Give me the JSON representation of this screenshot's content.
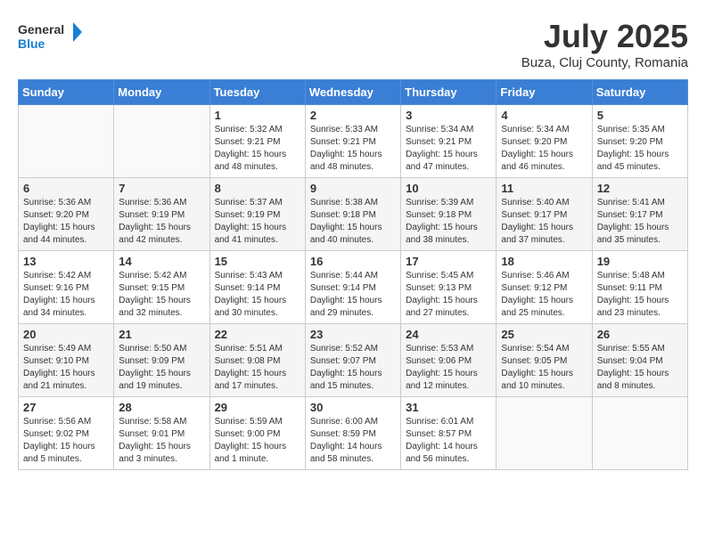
{
  "header": {
    "logo_line1": "General",
    "logo_line2": "Blue",
    "month": "July 2025",
    "location": "Buza, Cluj County, Romania"
  },
  "weekdays": [
    "Sunday",
    "Monday",
    "Tuesday",
    "Wednesday",
    "Thursday",
    "Friday",
    "Saturday"
  ],
  "weeks": [
    [
      {
        "day": "",
        "info": ""
      },
      {
        "day": "",
        "info": ""
      },
      {
        "day": "1",
        "info": "Sunrise: 5:32 AM\nSunset: 9:21 PM\nDaylight: 15 hours and 48 minutes."
      },
      {
        "day": "2",
        "info": "Sunrise: 5:33 AM\nSunset: 9:21 PM\nDaylight: 15 hours and 48 minutes."
      },
      {
        "day": "3",
        "info": "Sunrise: 5:34 AM\nSunset: 9:21 PM\nDaylight: 15 hours and 47 minutes."
      },
      {
        "day": "4",
        "info": "Sunrise: 5:34 AM\nSunset: 9:20 PM\nDaylight: 15 hours and 46 minutes."
      },
      {
        "day": "5",
        "info": "Sunrise: 5:35 AM\nSunset: 9:20 PM\nDaylight: 15 hours and 45 minutes."
      }
    ],
    [
      {
        "day": "6",
        "info": "Sunrise: 5:36 AM\nSunset: 9:20 PM\nDaylight: 15 hours and 44 minutes."
      },
      {
        "day": "7",
        "info": "Sunrise: 5:36 AM\nSunset: 9:19 PM\nDaylight: 15 hours and 42 minutes."
      },
      {
        "day": "8",
        "info": "Sunrise: 5:37 AM\nSunset: 9:19 PM\nDaylight: 15 hours and 41 minutes."
      },
      {
        "day": "9",
        "info": "Sunrise: 5:38 AM\nSunset: 9:18 PM\nDaylight: 15 hours and 40 minutes."
      },
      {
        "day": "10",
        "info": "Sunrise: 5:39 AM\nSunset: 9:18 PM\nDaylight: 15 hours and 38 minutes."
      },
      {
        "day": "11",
        "info": "Sunrise: 5:40 AM\nSunset: 9:17 PM\nDaylight: 15 hours and 37 minutes."
      },
      {
        "day": "12",
        "info": "Sunrise: 5:41 AM\nSunset: 9:17 PM\nDaylight: 15 hours and 35 minutes."
      }
    ],
    [
      {
        "day": "13",
        "info": "Sunrise: 5:42 AM\nSunset: 9:16 PM\nDaylight: 15 hours and 34 minutes."
      },
      {
        "day": "14",
        "info": "Sunrise: 5:42 AM\nSunset: 9:15 PM\nDaylight: 15 hours and 32 minutes."
      },
      {
        "day": "15",
        "info": "Sunrise: 5:43 AM\nSunset: 9:14 PM\nDaylight: 15 hours and 30 minutes."
      },
      {
        "day": "16",
        "info": "Sunrise: 5:44 AM\nSunset: 9:14 PM\nDaylight: 15 hours and 29 minutes."
      },
      {
        "day": "17",
        "info": "Sunrise: 5:45 AM\nSunset: 9:13 PM\nDaylight: 15 hours and 27 minutes."
      },
      {
        "day": "18",
        "info": "Sunrise: 5:46 AM\nSunset: 9:12 PM\nDaylight: 15 hours and 25 minutes."
      },
      {
        "day": "19",
        "info": "Sunrise: 5:48 AM\nSunset: 9:11 PM\nDaylight: 15 hours and 23 minutes."
      }
    ],
    [
      {
        "day": "20",
        "info": "Sunrise: 5:49 AM\nSunset: 9:10 PM\nDaylight: 15 hours and 21 minutes."
      },
      {
        "day": "21",
        "info": "Sunrise: 5:50 AM\nSunset: 9:09 PM\nDaylight: 15 hours and 19 minutes."
      },
      {
        "day": "22",
        "info": "Sunrise: 5:51 AM\nSunset: 9:08 PM\nDaylight: 15 hours and 17 minutes."
      },
      {
        "day": "23",
        "info": "Sunrise: 5:52 AM\nSunset: 9:07 PM\nDaylight: 15 hours and 15 minutes."
      },
      {
        "day": "24",
        "info": "Sunrise: 5:53 AM\nSunset: 9:06 PM\nDaylight: 15 hours and 12 minutes."
      },
      {
        "day": "25",
        "info": "Sunrise: 5:54 AM\nSunset: 9:05 PM\nDaylight: 15 hours and 10 minutes."
      },
      {
        "day": "26",
        "info": "Sunrise: 5:55 AM\nSunset: 9:04 PM\nDaylight: 15 hours and 8 minutes."
      }
    ],
    [
      {
        "day": "27",
        "info": "Sunrise: 5:56 AM\nSunset: 9:02 PM\nDaylight: 15 hours and 5 minutes."
      },
      {
        "day": "28",
        "info": "Sunrise: 5:58 AM\nSunset: 9:01 PM\nDaylight: 15 hours and 3 minutes."
      },
      {
        "day": "29",
        "info": "Sunrise: 5:59 AM\nSunset: 9:00 PM\nDaylight: 15 hours and 1 minute."
      },
      {
        "day": "30",
        "info": "Sunrise: 6:00 AM\nSunset: 8:59 PM\nDaylight: 14 hours and 58 minutes."
      },
      {
        "day": "31",
        "info": "Sunrise: 6:01 AM\nSunset: 8:57 PM\nDaylight: 14 hours and 56 minutes."
      },
      {
        "day": "",
        "info": ""
      },
      {
        "day": "",
        "info": ""
      }
    ]
  ]
}
